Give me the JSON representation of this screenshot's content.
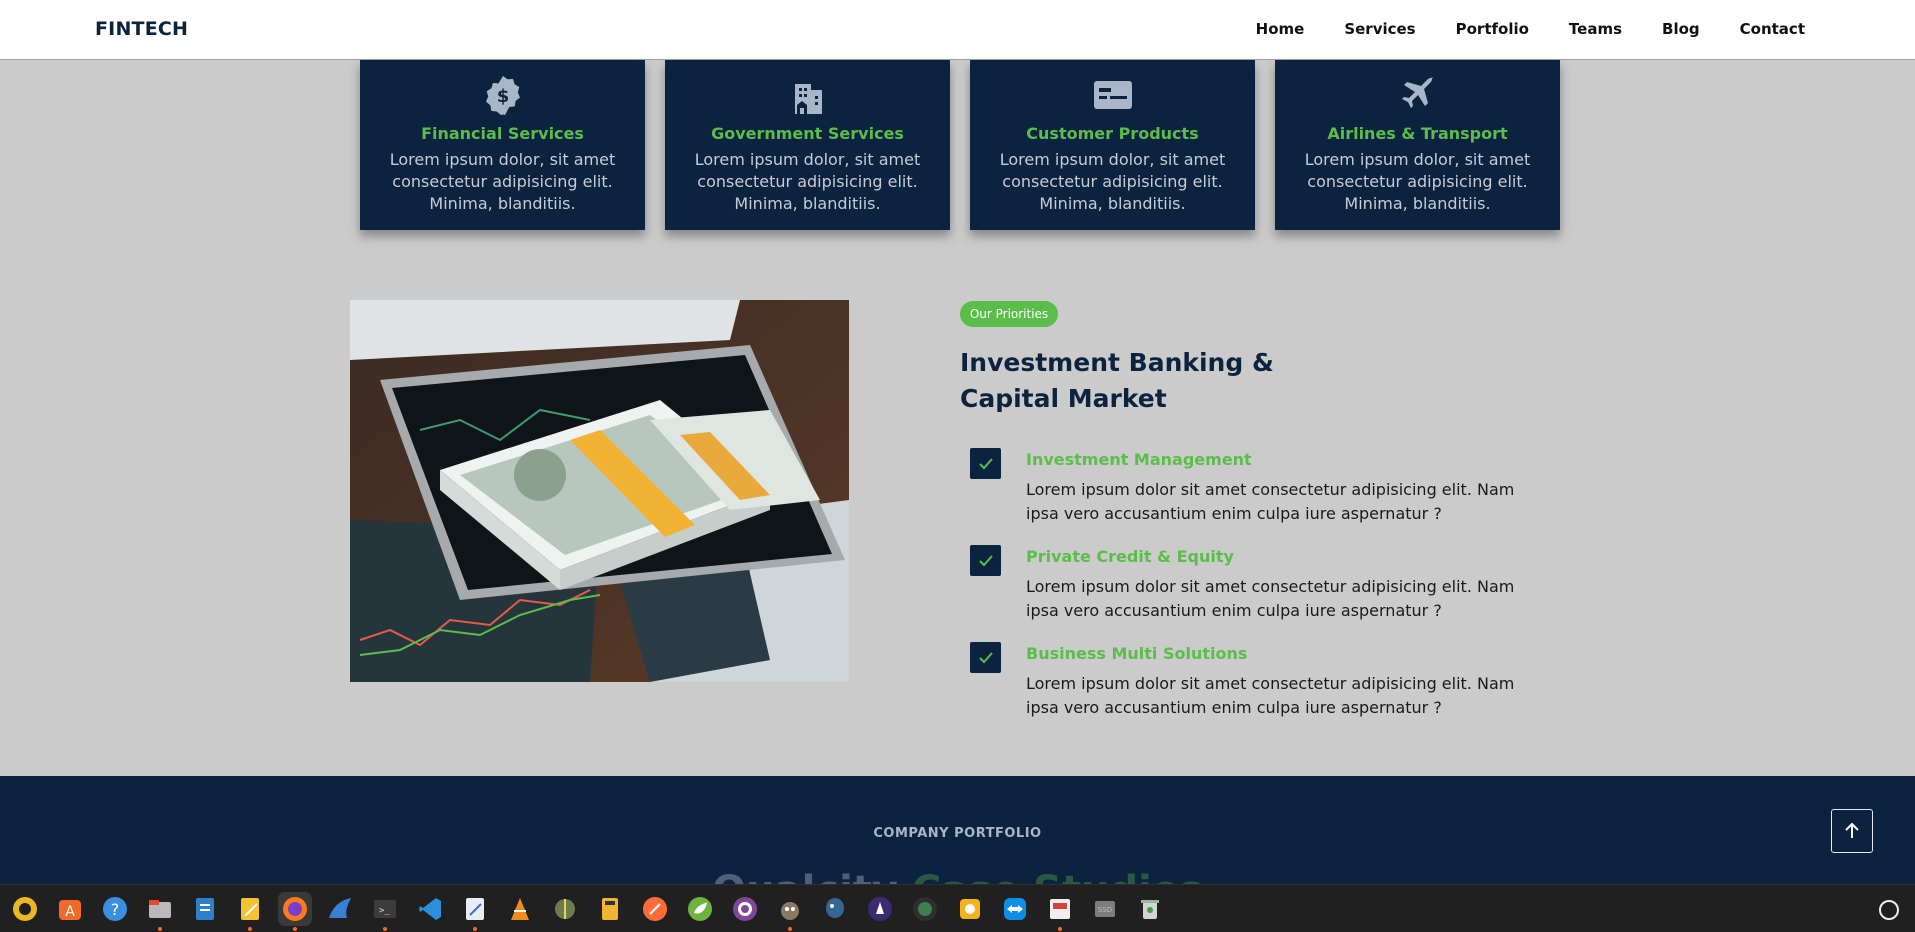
{
  "nav": {
    "brand": "FINTECH",
    "links": [
      "Home",
      "Services",
      "Portfolio",
      "Teams",
      "Blog",
      "Contact"
    ]
  },
  "cards": [
    {
      "icon": "dollar-badge-icon",
      "title": "Financial Services",
      "desc": "Lorem ipsum dolor, sit amet consectetur adipisicing elit. Minima, blanditiis."
    },
    {
      "icon": "building-icon",
      "title": "Government Services",
      "desc": "Lorem ipsum dolor, sit amet consectetur adipisicing elit. Minima, blanditiis."
    },
    {
      "icon": "id-card-icon",
      "title": "Customer Products",
      "desc": "Lorem ipsum dolor, sit amet consectetur adipisicing elit. Minima, blanditiis."
    },
    {
      "icon": "airplane-icon",
      "title": "Airlines & Transport",
      "desc": "Lorem ipsum dolor, sit amet consectetur adipisicing elit. Minima, blanditiis."
    }
  ],
  "priorities": {
    "badge": "Our Priorities",
    "heading_line1": "Investment Banking &",
    "heading_line2": "Capital Market",
    "items": [
      {
        "title": "Investment Management",
        "text": "Lorem ipsum dolor sit amet consectetur adipisicing elit. Nam ipsa vero accusantium enim culpa iure aspernatur ?"
      },
      {
        "title": "Private Credit & Equity",
        "text": "Lorem ipsum dolor sit amet consectetur adipisicing elit. Nam ipsa vero accusantium enim culpa iure aspernatur ?"
      },
      {
        "title": "Business Multi Solutions",
        "text": "Lorem ipsum dolor sit amet consectetur adipisicing elit. Nam ipsa vero accusantium enim culpa iure aspernatur ?"
      }
    ]
  },
  "portfolio": {
    "kicker": "COMPANY PORTFOLIO",
    "title_part1": "Qualcity",
    "title_part2": "Case Studies"
  },
  "colors": {
    "navy": "#0c2340",
    "green": "#5bbd4a",
    "background": "#cbcbcb"
  },
  "taskbar": {
    "apps": [
      "rhythmbox-icon",
      "software-store-icon",
      "help-icon",
      "files-icon",
      "libreoffice-writer-icon",
      "text-editor-icon",
      "firefox-icon",
      "shark-icon",
      "terminal-icon",
      "vscode-icon",
      "notes-icon",
      "vlc-icon",
      "network-icon",
      "calculator-icon",
      "postman-icon",
      "spring-icon",
      "tor-icon",
      "gimp-icon",
      "postgres-icon",
      "unicorn-icon",
      "camera-icon",
      "paint-icon",
      "teamviewer-icon",
      "presentation-icon",
      "disk-icon",
      "trash-icon"
    ]
  }
}
